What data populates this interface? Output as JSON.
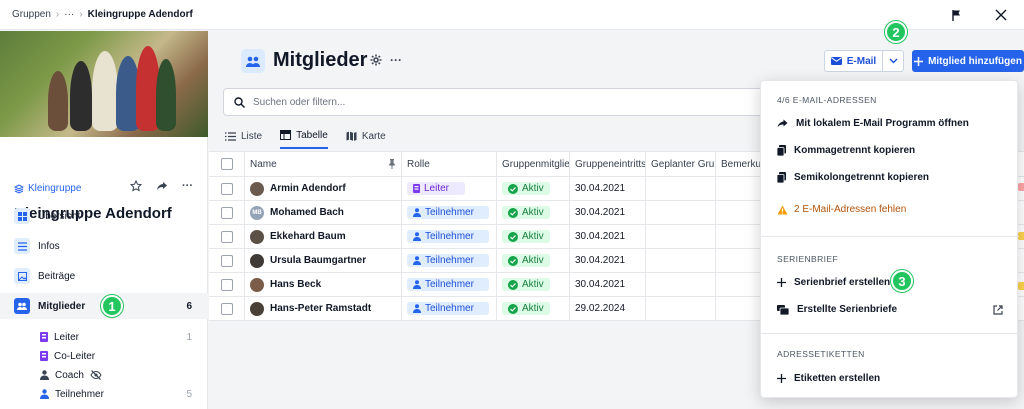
{
  "breadcrumb": {
    "root": "Gruppen",
    "ellipsis": "···",
    "current": "Kleingruppe Adendorf"
  },
  "sidebar": {
    "group_type": "Kleingruppe",
    "group_name": "Kleingruppe Adendorf",
    "nav": [
      {
        "label": "Übersicht",
        "icon": "grid-icon"
      },
      {
        "label": "Infos",
        "icon": "list-icon"
      },
      {
        "label": "Beiträge",
        "icon": "image-icon"
      },
      {
        "label": "Mitglieder",
        "icon": "people-icon",
        "count": "6",
        "active": true
      }
    ],
    "roles": [
      {
        "label": "Leiter",
        "count": "1",
        "color": "#7c3aed"
      },
      {
        "label": "Co-Leiter",
        "count": "",
        "color": "#7c3aed"
      },
      {
        "label": "Coach",
        "count": "",
        "color": "#374151"
      },
      {
        "label": "Teilnehmer",
        "count": "5",
        "color": "#2563eb"
      }
    ]
  },
  "steps": {
    "one": "1",
    "two": "2",
    "three": "3"
  },
  "header": {
    "title": "Mitglieder",
    "more": "···",
    "email_label": "E-Mail",
    "add_label": "Mitglied hinzufügen"
  },
  "search": {
    "placeholder": "Suchen oder filtern..."
  },
  "views": [
    {
      "label": "Liste",
      "icon": "list-view-icon"
    },
    {
      "label": "Tabelle",
      "icon": "table-view-icon",
      "active": true
    },
    {
      "label": "Karte",
      "icon": "map-view-icon"
    }
  ],
  "table": {
    "columns": [
      "Name",
      "Rolle",
      "Gruppenmitglieds",
      "Gruppeneintritts",
      "Geplanter Gru",
      "Bemerku"
    ],
    "rows": [
      {
        "name": "Armin Adendorf",
        "initials": "",
        "role": "Leiter",
        "status": "Aktiv",
        "date": "30.04.2021"
      },
      {
        "name": "Mohamed Bach",
        "initials": "MB",
        "role": "Teilnehmer",
        "status": "Aktiv",
        "date": "30.04.2021"
      },
      {
        "name": "Ekkehard Baum",
        "initials": "",
        "role": "Teilnehmer",
        "status": "Aktiv",
        "date": "30.04.2021"
      },
      {
        "name": "Ursula Baumgartner",
        "initials": "",
        "role": "Teilnehmer",
        "status": "Aktiv",
        "date": "30.04.2021"
      },
      {
        "name": "Hans Beck",
        "initials": "",
        "role": "Teilnehmer",
        "status": "Aktiv",
        "date": "30.04.2021"
      },
      {
        "name": "Hans-Peter Ramstadt",
        "initials": "",
        "role": "Teilnehmer",
        "status": "Aktiv",
        "date": "29.02.2024"
      }
    ]
  },
  "dropdown": {
    "email_section": "4/6 E-MAIL-ADRESSEN",
    "open_local": "Mit lokalem E-Mail Programm öffnen",
    "copy_comma": "Kommagetrennt kopieren",
    "copy_semicolon": "Semikolongetrennt kopieren",
    "missing": "2 E-Mail-Adressen fehlen",
    "serial_section": "SERIENBRIEF",
    "create_serial": "Serienbrief erstellen",
    "created_serials": "Erstellte Serienbriefe",
    "labels_section": "ADRESSETIKETTEN",
    "create_labels": "Etiketten erstellen"
  },
  "colors": {
    "primary": "#2563eb",
    "success": "#22c55e",
    "warning": "#f59e0b"
  }
}
